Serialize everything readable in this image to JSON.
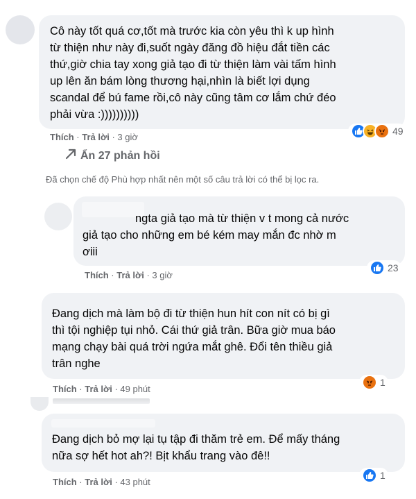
{
  "comments": [
    {
      "text": "Cô này tốt quá cơ,tốt mà trước kia còn yêu thì k up hình\ntừ thiện như này đi,suốt ngày đăng đồ hiệu đắt tiền các\nthứ,giờ chia tay xong giả tạo đi từ thiện làm vài tấm hình\nup lên ăn bám lòng thương hại,nhìn là biết lợi dụng\nscandal để bú fame rồi,cô này cũng tâm cơ lắm chứ đéo\nphải vừa :))))))))))",
      "like": "Thích",
      "reply": "Trả lời",
      "time": "3 giờ",
      "reactions": [
        "like",
        "haha",
        "angry"
      ],
      "reaction_count": "49"
    },
    {
      "text": "ngta giả tạo mà từ thiện v t mong cả nước\ngiả tạo cho những em bé kém may mắn đc nhờ m\nơiii",
      "like": "Thích",
      "reply": "Trả lời",
      "time": "3 giờ",
      "reactions": [
        "like"
      ],
      "reaction_count": "23"
    },
    {
      "text": "Đang dịch mà làm bộ đi từ thiện hun hít con nít có bị gì\nthì tội nghiệp tụi nhỏ. Cái thứ giả trân. Bữa giờ mua báo\nmạng chạy bài quá trời ngứa mắt ghê. Đổi tên thiều giả\ntrân nghe",
      "like": "Thích",
      "reply": "Trả lời",
      "time": "49 phút",
      "reactions": [
        "angry"
      ],
      "reaction_count": "1"
    },
    {
      "text": "Đang dịch bỏ mợ lại tụ tập đi thăm trẻ em. Để mấy tháng\nnữa sợ hết hot ah?! Bịt khẩu trang vào đê!!",
      "like": "Thích",
      "reply": "Trả lời",
      "time": "43 phút",
      "reactions": [
        "like"
      ],
      "reaction_count": "1"
    }
  ],
  "hidden_replies": "Ẩn 27 phản hồi",
  "filter_notice": "Đã chọn chế độ Phù hợp nhất nên một số câu trả lời có thể bị lọc ra.",
  "colors": {
    "like": "#1877f2",
    "haha": "#f7b125",
    "angry": "#e9710f",
    "bubble": "#f0f2f5",
    "meta": "#65676b"
  }
}
